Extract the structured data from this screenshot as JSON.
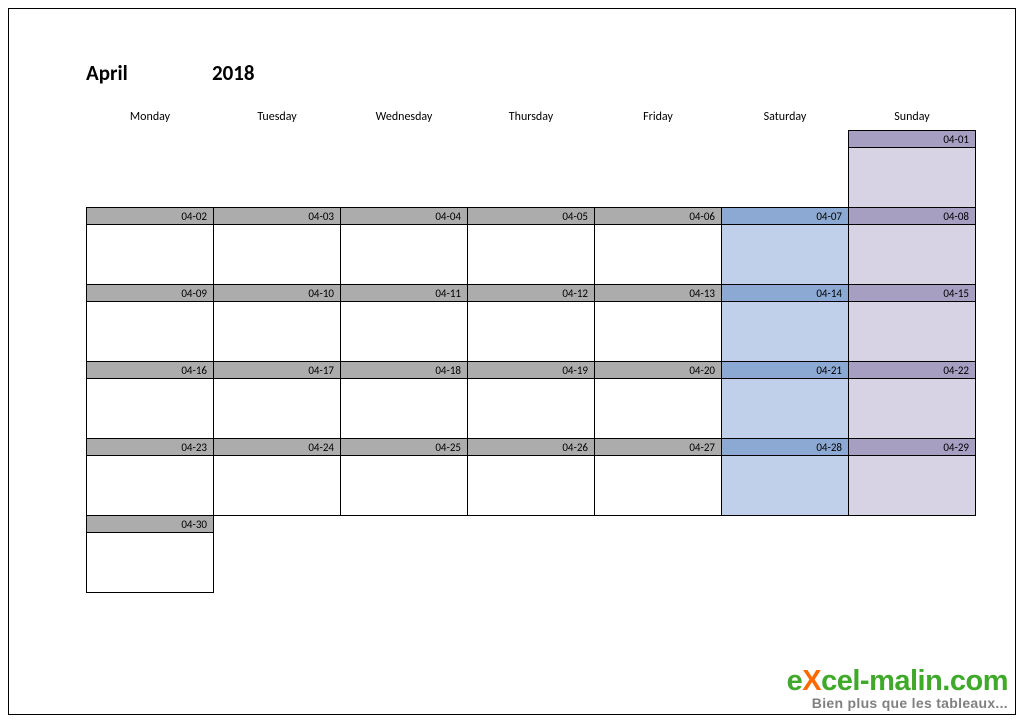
{
  "title": {
    "month": "April",
    "year": "2018"
  },
  "daysOfWeek": [
    "Monday",
    "Tuesday",
    "Wednesday",
    "Thursday",
    "Friday",
    "Saturday",
    "Sunday"
  ],
  "weeks": [
    [
      {
        "empty": true
      },
      {
        "empty": true
      },
      {
        "empty": true
      },
      {
        "empty": true
      },
      {
        "empty": true
      },
      {
        "empty": true
      },
      {
        "date": "04-01",
        "type": "sun"
      }
    ],
    [
      {
        "date": "04-02",
        "type": "wd"
      },
      {
        "date": "04-03",
        "type": "wd"
      },
      {
        "date": "04-04",
        "type": "wd"
      },
      {
        "date": "04-05",
        "type": "wd"
      },
      {
        "date": "04-06",
        "type": "wd"
      },
      {
        "date": "04-07",
        "type": "sat"
      },
      {
        "date": "04-08",
        "type": "sun"
      }
    ],
    [
      {
        "date": "04-09",
        "type": "wd"
      },
      {
        "date": "04-10",
        "type": "wd"
      },
      {
        "date": "04-11",
        "type": "wd"
      },
      {
        "date": "04-12",
        "type": "wd"
      },
      {
        "date": "04-13",
        "type": "wd"
      },
      {
        "date": "04-14",
        "type": "sat"
      },
      {
        "date": "04-15",
        "type": "sun"
      }
    ],
    [
      {
        "date": "04-16",
        "type": "wd"
      },
      {
        "date": "04-17",
        "type": "wd"
      },
      {
        "date": "04-18",
        "type": "wd"
      },
      {
        "date": "04-19",
        "type": "wd"
      },
      {
        "date": "04-20",
        "type": "wd"
      },
      {
        "date": "04-21",
        "type": "sat"
      },
      {
        "date": "04-22",
        "type": "sun"
      }
    ],
    [
      {
        "date": "04-23",
        "type": "wd"
      },
      {
        "date": "04-24",
        "type": "wd"
      },
      {
        "date": "04-25",
        "type": "wd"
      },
      {
        "date": "04-26",
        "type": "wd"
      },
      {
        "date": "04-27",
        "type": "wd"
      },
      {
        "date": "04-28",
        "type": "sat"
      },
      {
        "date": "04-29",
        "type": "sun"
      }
    ],
    [
      {
        "date": "04-30",
        "type": "wd"
      },
      {
        "empty": true
      },
      {
        "empty": true
      },
      {
        "empty": true
      },
      {
        "empty": true
      },
      {
        "empty": true
      },
      {
        "empty": true
      }
    ]
  ],
  "footer": {
    "brand_pre": "e",
    "brand_x": "X",
    "brand_post": "cel-malin.com",
    "tagline": "Bien plus que les tableaux..."
  }
}
